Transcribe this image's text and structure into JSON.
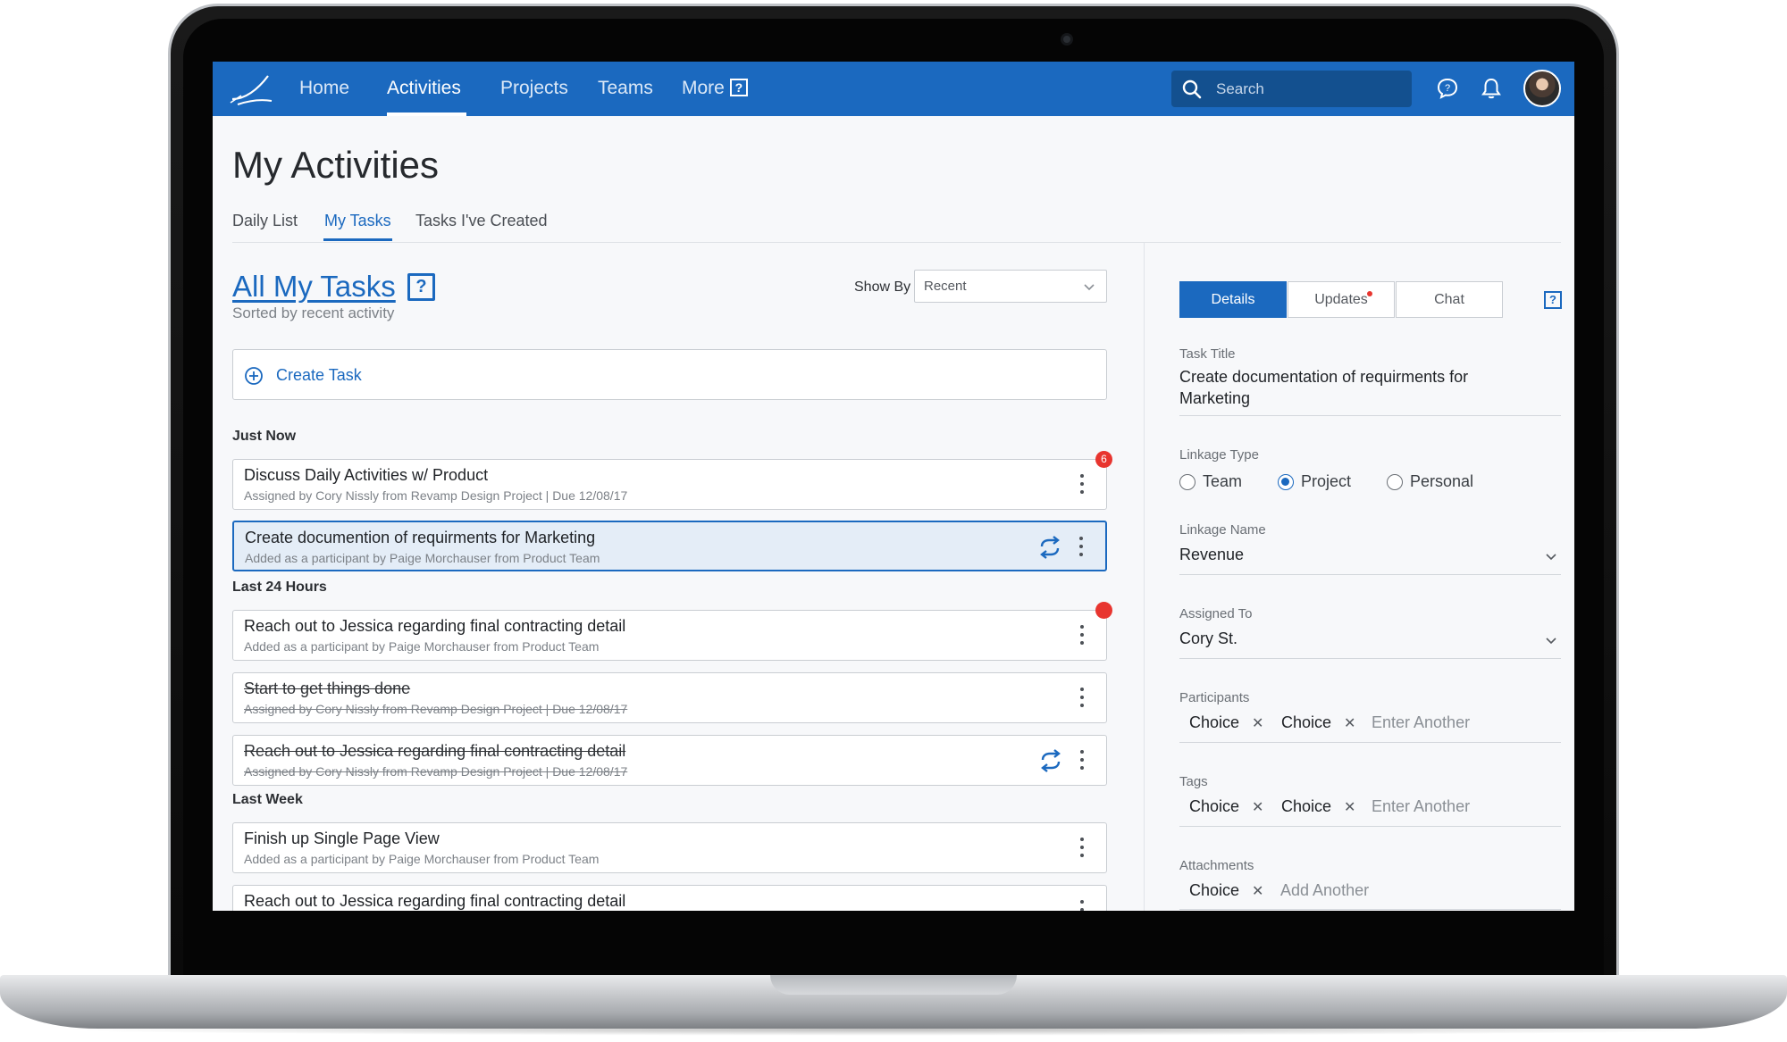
{
  "nav": {
    "items": [
      "Home",
      "Activities",
      "Projects",
      "Teams",
      "More"
    ],
    "active": "Activities",
    "search_placeholder": "Search"
  },
  "page": {
    "title": "My Activities",
    "subtabs": [
      "Daily List",
      "My Tasks",
      "Tasks I've Created"
    ],
    "active_subtab": "My Tasks"
  },
  "list": {
    "heading": "All My Tasks",
    "help": "?",
    "subheading": "Sorted by recent activity",
    "show_by_label": "Show By",
    "show_by_value": "Recent",
    "create_label": "Create Task",
    "sections": {
      "just_now": "Just Now",
      "last_24": "Last 24 Hours",
      "last_week": "Last Week"
    },
    "tasks": [
      {
        "title": "Discuss Daily Activities w/ Product",
        "sub": "Assigned by Cory Nissly from Revamp Design Project | Due 12/08/17",
        "badge": "6"
      },
      {
        "title": "Create documention of requirments for Marketing",
        "sub": "Added as a participant by Paige Morchauser from Product Team"
      },
      {
        "title": "Reach out to Jessica regarding final contracting detail",
        "sub": "Added as a participant by Paige Morchauser from Product Team"
      },
      {
        "title": "Start to get things done",
        "sub": "Assigned  by Cory Nissly from Revamp Design Project | Due 12/08/17"
      },
      {
        "title": "Reach out to Jessica regarding final contracting detail",
        "sub": "Assigned by Cory Nissly from Revamp Design Project | Due 12/08/17"
      },
      {
        "title": "Finish up Single Page View",
        "sub": "Added as a participant by Paige Morchauser from Product Team"
      },
      {
        "title": "Reach out to Jessica regarding final contracting detail",
        "sub": ""
      }
    ]
  },
  "details": {
    "tabs": [
      "Details",
      "Updates",
      "Chat"
    ],
    "active_tab": "Details",
    "help": "?",
    "task_title_label": "Task Title",
    "task_title_line1": "Create documentation of requirments for",
    "task_title_line2": "Marketing",
    "linkage_type_label": "Linkage Type",
    "linkage_options": [
      "Team",
      "Project",
      "Personal"
    ],
    "linkage_selected": "Project",
    "linkage_name_label": "Linkage Name",
    "linkage_name_value": "Revenue",
    "assigned_to_label": "Assigned To",
    "assigned_to_value": "Cory St.",
    "participants_label": "Participants",
    "participants": [
      "Choice",
      "Choice"
    ],
    "participants_placeholder": "Enter Another",
    "tags_label": "Tags",
    "tags": [
      "Choice",
      "Choice"
    ],
    "tags_placeholder": "Enter Another",
    "attachments_label": "Attachments",
    "attachments": [
      "Choice"
    ],
    "attachments_placeholder": "Add Another"
  },
  "colors": {
    "brand": "#1b69bf",
    "nav_bg": "#1b69bf",
    "badge": "#e8352f",
    "selected_row": "#e4edf7"
  },
  "icons": [
    "logo-icon",
    "help-icon",
    "search-icon",
    "chat-bubble-icon",
    "bell-icon",
    "avatar",
    "plus-circle-icon",
    "kebab-menu-icon",
    "repeat-icon",
    "chevron-down-icon",
    "close-icon"
  ]
}
